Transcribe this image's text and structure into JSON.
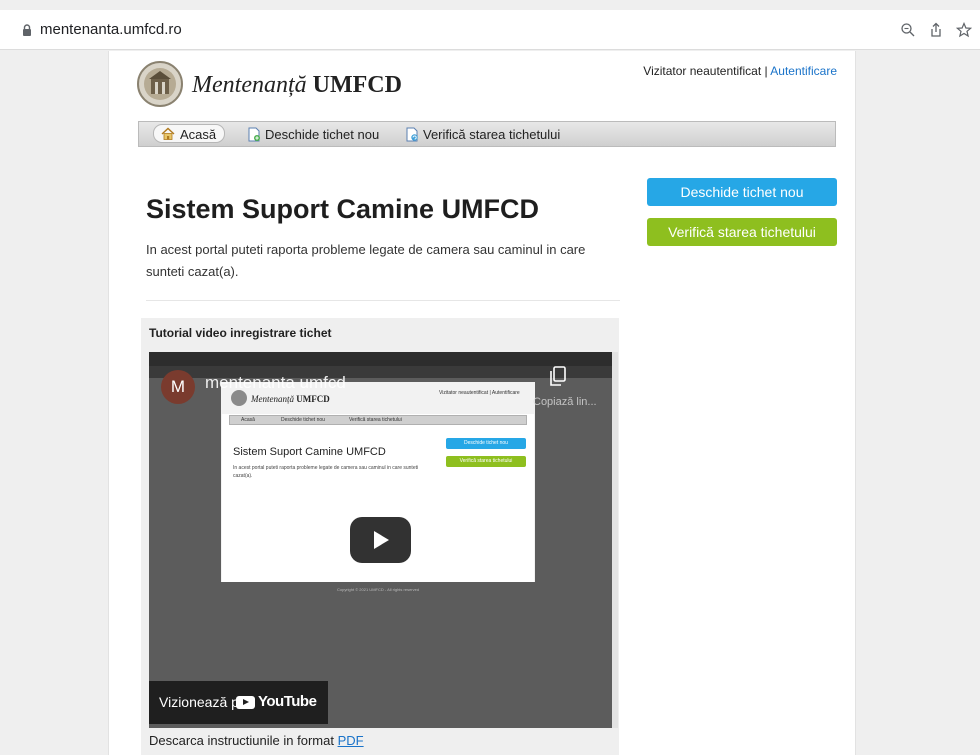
{
  "browser": {
    "url": "mentenanta.umfcd.ro"
  },
  "header": {
    "brand_italic": "Mentenanță",
    "brand_bold": "UMFCD",
    "visitor_text": "Vizitator neautentificat",
    "separator": "|",
    "login_link": "Autentificare"
  },
  "nav": {
    "items": [
      {
        "label": "Acasă"
      },
      {
        "label": "Deschide tichet nou"
      },
      {
        "label": "Verifică starea tichetului"
      }
    ]
  },
  "main": {
    "title": "Sistem Suport Camine UMFCD",
    "intro": "In acest portal puteti raporta probleme legate de camera sau caminul in care sunteti cazat(a)."
  },
  "sidebar": {
    "open_ticket_button": "Deschide tichet nou",
    "check_status_button": "Verifică starea tichetului"
  },
  "tutorial": {
    "title": "Tutorial video inregistrare tichet",
    "video": {
      "channel_initial": "M",
      "channel_name": "mentenanta umfcd",
      "copy_link_label": "Copiază lin...",
      "watch_on": "Vizionează pe",
      "youtube_label": "YouTube",
      "inner_brand_italic": "Mentenanță",
      "inner_brand_bold": "UMFCD",
      "inner_user": "Vizitator neautentificat | Autentificare",
      "inner_nav": [
        "Acasă",
        "Deschide tichet nou",
        "Verifică starea tichetului"
      ],
      "inner_title": "Sistem Suport Camine UMFCD",
      "inner_intro": "In acest portal puteti raporta probleme legate de camera sau caminul in care sunteti cazat(a).",
      "inner_btn_open": "Deschide tichet nou",
      "inner_btn_check": "Verifică starea tichetului",
      "inner_copyright": "Copyright © 2021 UMFCD - All rights reserved"
    },
    "pdf_prefix": "Descarca instructiunile in format",
    "pdf_link": "PDF"
  },
  "colors": {
    "accent_blue": "#26a7e6",
    "accent_green": "#8ebf1f",
    "link": "#1a73c9"
  }
}
